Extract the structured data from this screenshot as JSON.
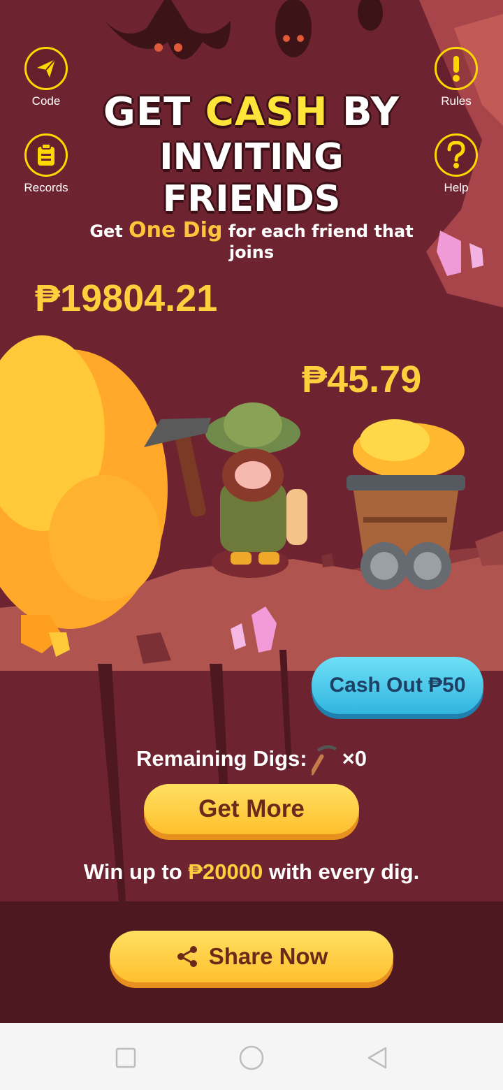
{
  "side_buttons": {
    "code": {
      "label": "Code"
    },
    "records": {
      "label": "Records"
    },
    "rules": {
      "label": "Rules"
    },
    "help": {
      "label": "Help"
    }
  },
  "headline": {
    "get": "GET",
    "cash": "CASH",
    "by": "BY",
    "line2": "INVITING FRIENDS"
  },
  "subline": {
    "pre": "Get",
    "highlight": "One Dig",
    "post": "for each friend that joins"
  },
  "balance": {
    "total": "₱19804.21",
    "cart": "₱45.79"
  },
  "cashout": {
    "label": "Cash Out ₱50"
  },
  "digs": {
    "label": "Remaining Digs:",
    "count": "×0"
  },
  "get_more": {
    "label": "Get More"
  },
  "win": {
    "pre": "Win up to",
    "amount": "₱20000",
    "post": "with every dig."
  },
  "share": {
    "label": "Share Now"
  },
  "colors": {
    "gold": "#ffcf3d",
    "accent_yellow": "#ffd800",
    "cashout_blue": "#43c3e8",
    "bg_maroon": "#6e2330"
  },
  "icons": [
    "paper-plane-icon",
    "clipboard-icon",
    "exclamation-icon",
    "question-icon",
    "pickaxe-icon",
    "share-icon"
  ]
}
